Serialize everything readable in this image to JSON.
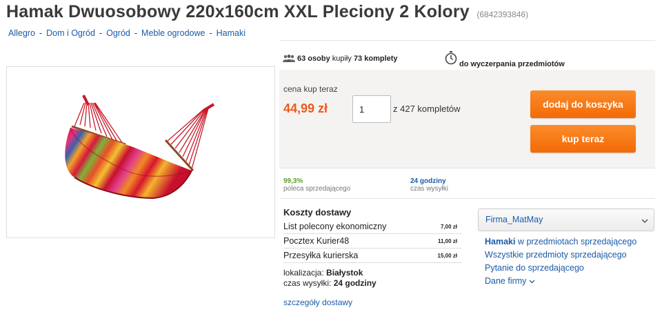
{
  "offer": {
    "title": "Hamak Dwuosobowy 220x160cm XXL Pleciony 2 Kolory",
    "id": "(6842393846)"
  },
  "breadcrumb": [
    "Allegro",
    "Dom i Ogród",
    "Ogród",
    "Meble ogrodowe",
    "Hamaki"
  ],
  "stats": {
    "buyers_bold": "63 osoby",
    "buyers_mid": "kupiły",
    "sets_bold": "73 komplety",
    "until": "do wyczerpania przedmiotów"
  },
  "buy": {
    "price_label": "cena kup teraz",
    "price": "44,99 zł",
    "qty_value": "1",
    "qty_note": "z 427 kompletów",
    "add_to_cart": "dodaj do koszyka",
    "buy_now": "kup teraz"
  },
  "seller_stats": {
    "recommend_value": "99,3%",
    "recommend_label": "poleca sprzedającego",
    "dispatch_value": "24 godziny",
    "dispatch_label": "czas wysyłki"
  },
  "shipping": {
    "title": "Koszty dostawy",
    "rows": [
      {
        "name": "List polecony ekonomiczny",
        "price": "7,00 zł"
      },
      {
        "name": "Pocztex Kurier48",
        "price": "11,00 zł"
      },
      {
        "name": "Przesyłka kurierska",
        "price": "15,00 zł"
      }
    ],
    "location_label": "lokalizacja:",
    "location": "Białystok",
    "dispatch_label": "czas wysyłki:",
    "dispatch": "24 godziny",
    "details_link": "szczegóły dostawy"
  },
  "seller": {
    "name": "Firma_MatMay",
    "link1_bold": "Hamaki",
    "link1_rest": "w przedmiotach sprzedającego",
    "link2": "Wszystkie przedmioty sprzedającego",
    "link3": "Pytanie do sprzedającego",
    "link4": "Dane firmy"
  },
  "colors": {
    "accent": "#f46a07",
    "price": "#f05a1a",
    "link": "#1a5aa8",
    "positive": "#5aa12c"
  },
  "icons": [
    "people-icon",
    "stopwatch-icon",
    "chevron-down-icon"
  ]
}
